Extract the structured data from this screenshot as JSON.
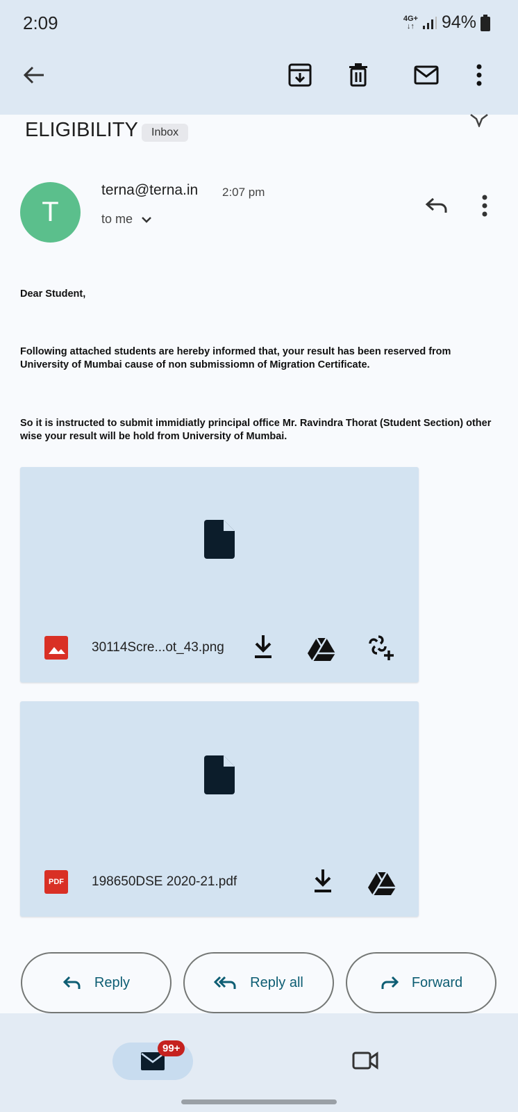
{
  "status_bar": {
    "time": "2:09",
    "network": "4G+",
    "battery": "94%"
  },
  "toolbar": {
    "icons": [
      "back-arrow-icon",
      "archive-icon",
      "delete-icon",
      "mark-unread-icon",
      "more-vert-icon"
    ]
  },
  "email": {
    "subject": "ELIGIBILITY",
    "label": "Inbox",
    "sender_initial": "T",
    "sender": "terna@terna.in",
    "time": "2:07 pm",
    "recipient": "to me",
    "body": {
      "greeting": "Dear Student,",
      "paragraph1": "Following attached students are hereby informed that, your result has been reserved from University of Mumbai cause of non submissiomn of Migration Certificate.",
      "paragraph2": "So it is instructed to submit immidiatly principal office Mr. Ravindra Thorat (Student Section) other wise your result will be hold from University of Mumbai."
    }
  },
  "attachments": [
    {
      "name": "30114Scre...ot_43.png",
      "type": "image",
      "type_label": ""
    },
    {
      "name": "198650DSE 2020-21.pdf",
      "type": "pdf",
      "type_label": "PDF"
    }
  ],
  "actions": {
    "reply": "Reply",
    "reply_all": "Reply all",
    "forward": "Forward"
  },
  "bottom_nav": {
    "mail_badge": "99+"
  },
  "colors": {
    "topbar": "#dde8f3",
    "avatar": "#5bbf8c",
    "attachment_bg": "#d3e3f1",
    "action_text": "#0d5d73",
    "badge": "#c5221f",
    "pdf": "#d93025"
  }
}
